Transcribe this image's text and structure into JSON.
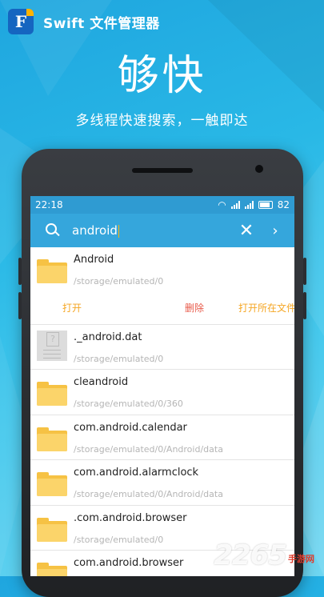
{
  "brand": {
    "logo_letter": "F",
    "app_name": "Swift 文件管理器"
  },
  "headline": "够快",
  "tagline": "多线程快速搜索，一触即达",
  "status_bar": {
    "time": "22:18",
    "battery": "82"
  },
  "search": {
    "query": "android"
  },
  "actions": {
    "open": "打开",
    "delete": "删除",
    "open_location": "打开所在文件.."
  },
  "items": [
    {
      "name": "Android",
      "path": "/storage/emulated/0",
      "icon": "folder-icon"
    },
    {
      "name": "._android.dat",
      "path": "/storage/emulated/0",
      "icon": "unknown-file-icon"
    },
    {
      "name": "cleandroid",
      "path": "/storage/emulated/0/360",
      "icon": "folder-icon"
    },
    {
      "name": "com.android.calendar",
      "path": "/storage/emulated/0/Android/data",
      "icon": "folder-icon"
    },
    {
      "name": "com.android.alarmclock",
      "path": "/storage/emulated/0/Android/data",
      "icon": "folder-icon"
    },
    {
      "name": ".com.android.browser",
      "path": "/storage/emulated/0",
      "icon": "folder-icon"
    },
    {
      "name": "com.android.browser",
      "path": "",
      "icon": "folder-icon"
    }
  ],
  "watermark": {
    "number": "2265",
    "text": "手游网"
  },
  "colors": {
    "accent": "#35a6dc",
    "status": "#2f9bd2",
    "open": "#f5a623",
    "delete": "#e85a4a",
    "folder": "#f6c244"
  }
}
